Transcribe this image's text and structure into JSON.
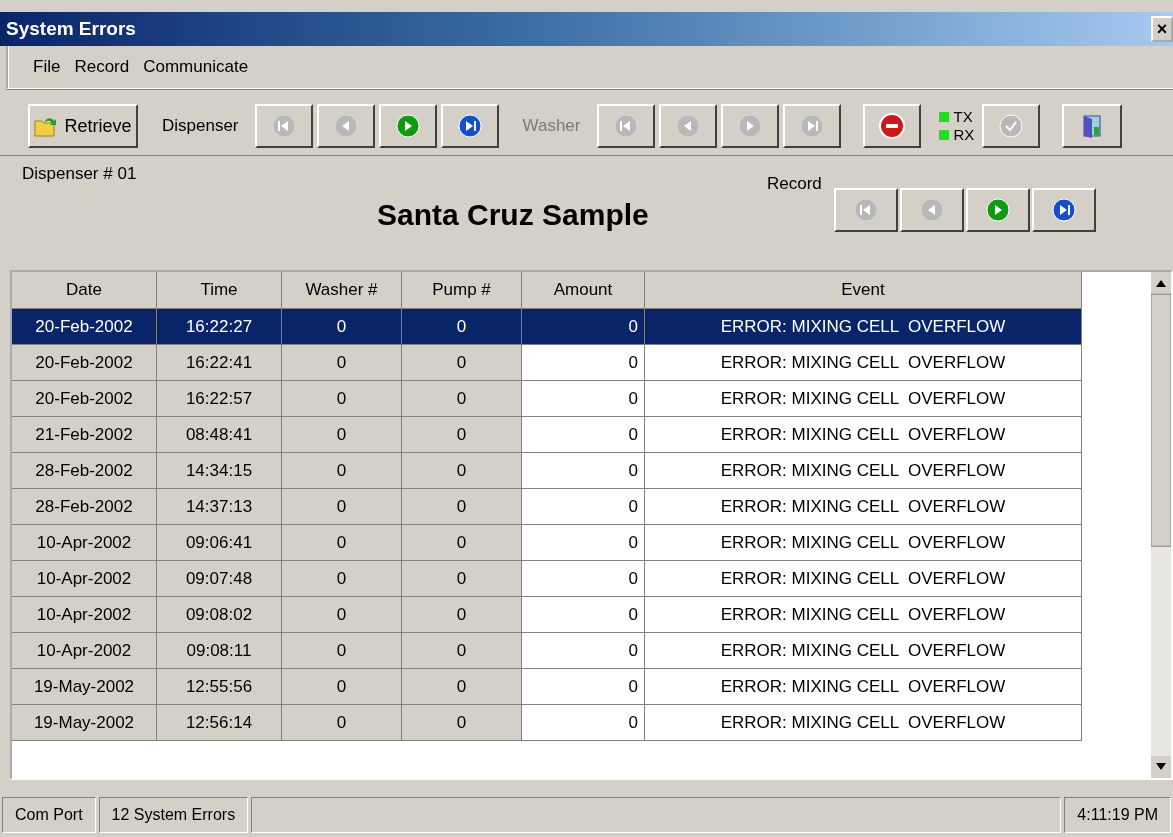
{
  "window": {
    "title": "System Errors",
    "close": "×"
  },
  "menu": [
    {
      "label": "File"
    },
    {
      "label": "Record"
    },
    {
      "label": "Communicate"
    }
  ],
  "toolbar": {
    "retrieve": "Retrieve",
    "groups": [
      {
        "label": "Dispenser",
        "disabled": false,
        "buttons": [
          {
            "kind": "first",
            "disabled": true
          },
          {
            "kind": "prev",
            "disabled": true
          },
          {
            "kind": "next",
            "disabled": false
          },
          {
            "kind": "last",
            "disabled": false
          }
        ]
      },
      {
        "label": "Washer",
        "disabled": true,
        "buttons": [
          {
            "kind": "first",
            "disabled": true
          },
          {
            "kind": "prev",
            "disabled": true
          },
          {
            "kind": "next",
            "disabled": true
          },
          {
            "kind": "last",
            "disabled": true
          }
        ]
      }
    ],
    "stop": {
      "disabled": false
    },
    "lights": [
      {
        "label": "TX",
        "on": true
      },
      {
        "label": "RX",
        "on": true
      }
    ],
    "check": {
      "disabled": true
    }
  },
  "header": {
    "dispenser": "Dispenser # 01",
    "title": "Santa Cruz Sample",
    "record_label": "Record",
    "record_buttons": [
      {
        "kind": "first",
        "disabled": true
      },
      {
        "kind": "prev",
        "disabled": true
      },
      {
        "kind": "next",
        "disabled": false
      },
      {
        "kind": "last",
        "disabled": false
      }
    ]
  },
  "table": {
    "columns": [
      "Date",
      "Time",
      "Washer #",
      "Pump #",
      "Amount",
      "Event"
    ],
    "rows": [
      {
        "cells": [
          "20-Feb-2002",
          "16:22:27",
          "0",
          "0",
          "0",
          "ERROR: MIXING CELL  OVERFLOW"
        ],
        "selected": true
      },
      {
        "cells": [
          "20-Feb-2002",
          "16:22:41",
          "0",
          "0",
          "0",
          "ERROR: MIXING CELL  OVERFLOW"
        ],
        "selected": false
      },
      {
        "cells": [
          "20-Feb-2002",
          "16:22:57",
          "0",
          "0",
          "0",
          "ERROR: MIXING CELL  OVERFLOW"
        ],
        "selected": false
      },
      {
        "cells": [
          "21-Feb-2002",
          "08:48:41",
          "0",
          "0",
          "0",
          "ERROR: MIXING CELL  OVERFLOW"
        ],
        "selected": false
      },
      {
        "cells": [
          "28-Feb-2002",
          "14:34:15",
          "0",
          "0",
          "0",
          "ERROR: MIXING CELL  OVERFLOW"
        ],
        "selected": false
      },
      {
        "cells": [
          "28-Feb-2002",
          "14:37:13",
          "0",
          "0",
          "0",
          "ERROR: MIXING CELL  OVERFLOW"
        ],
        "selected": false
      },
      {
        "cells": [
          "10-Apr-2002",
          "09:06:41",
          "0",
          "0",
          "0",
          "ERROR: MIXING CELL  OVERFLOW"
        ],
        "selected": false
      },
      {
        "cells": [
          "10-Apr-2002",
          "09:07:48",
          "0",
          "0",
          "0",
          "ERROR: MIXING CELL  OVERFLOW"
        ],
        "selected": false
      },
      {
        "cells": [
          "10-Apr-2002",
          "09:08:02",
          "0",
          "0",
          "0",
          "ERROR: MIXING CELL  OVERFLOW"
        ],
        "selected": false
      },
      {
        "cells": [
          "10-Apr-2002",
          "09:08:11",
          "0",
          "0",
          "0",
          "ERROR: MIXING CELL  OVERFLOW"
        ],
        "selected": false
      },
      {
        "cells": [
          "19-May-2002",
          "12:55:56",
          "0",
          "0",
          "0",
          "ERROR: MIXING CELL  OVERFLOW"
        ],
        "selected": false
      },
      {
        "cells": [
          "19-May-2002",
          "12:56:14",
          "0",
          "0",
          "0",
          "ERROR: MIXING CELL  OVERFLOW"
        ],
        "selected": false
      }
    ]
  },
  "status_bar": {
    "port": "Com Port",
    "count": "12 System Errors",
    "time": "4:11:19 PM"
  }
}
